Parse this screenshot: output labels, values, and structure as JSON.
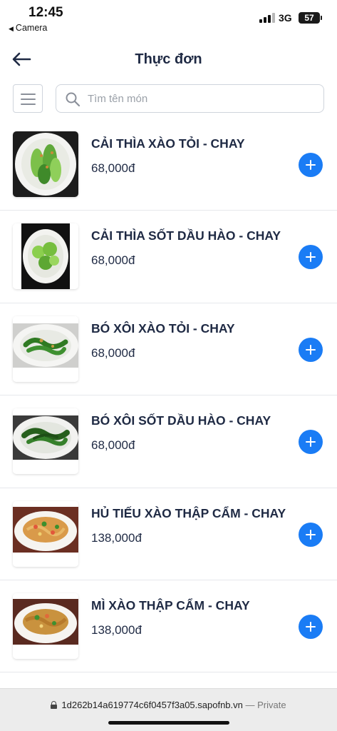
{
  "status_bar": {
    "time": "12:45",
    "back_app": "Camera",
    "network": "3G",
    "battery": "57"
  },
  "header": {
    "title": "Thực đơn"
  },
  "search": {
    "placeholder": "Tìm tên món"
  },
  "menu_items": [
    {
      "name": "CẢI THÌA XÀO TỎI - CHAY",
      "price": "68,000đ",
      "image": "pak-choi-garlic-dish"
    },
    {
      "name": "CẢI THÌA SỐT DẦU HÀO - CHAY",
      "price": "68,000đ",
      "image": "pak-choi-oyster-sauce-dish"
    },
    {
      "name": "BÓ XÔI XÀO TỎI - CHAY",
      "price": "68,000đ",
      "image": "spinach-garlic-dish"
    },
    {
      "name": "BÓ XÔI SỐT DẦU HÀO - CHAY",
      "price": "68,000đ",
      "image": "spinach-oyster-sauce-dish"
    },
    {
      "name": "HỦ TIẾU XÀO THẬP CẨM - CHAY",
      "price": "138,000đ",
      "image": "stir-fried-rice-noodle-dish"
    },
    {
      "name": "MÌ XÀO THẬP CẨM - CHAY",
      "price": "138,000đ",
      "image": "stir-fried-noodle-dish"
    }
  ],
  "url_bar": {
    "url": "1d262b14a619774c6f0457f3a05.sapofnb.vn",
    "separator": " — ",
    "mode": "Private"
  },
  "colors": {
    "accent": "#1a7cf5",
    "title_text": "#1f2a44",
    "divider": "#e6e8ec"
  }
}
